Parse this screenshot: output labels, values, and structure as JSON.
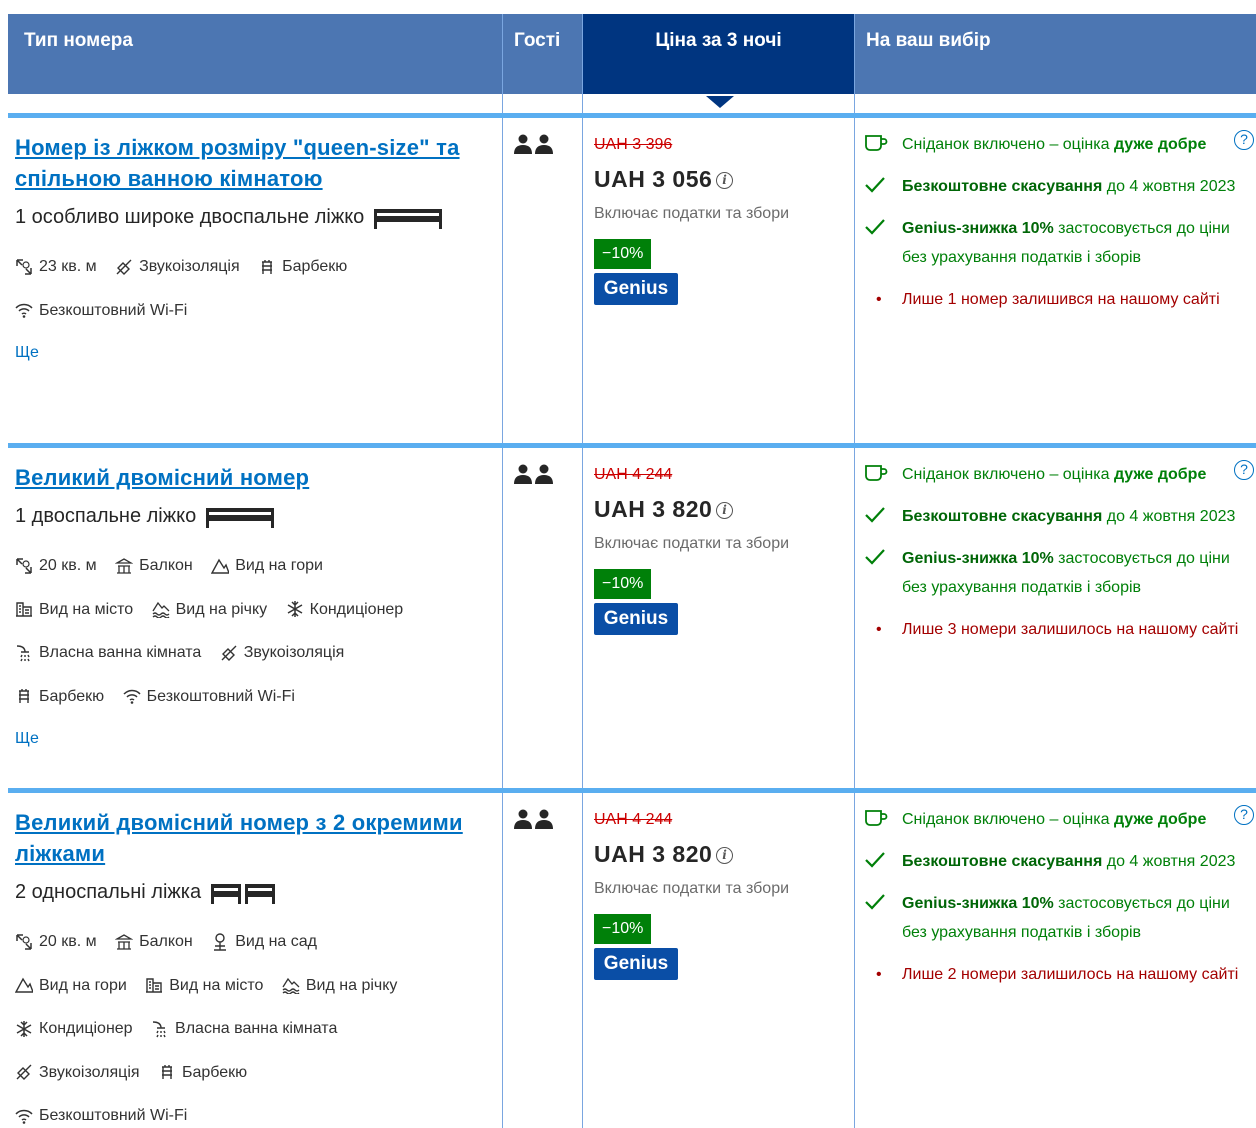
{
  "header": {
    "room_type": "Тип номера",
    "guests": "Гості",
    "price": "Ціна за 3 ночі",
    "choice": "На ваш вибір"
  },
  "rooms": [
    {
      "title": "Номер із ліжком розміру \"queen-size\" та спільною ванною кімнатою",
      "bed": "1 особливо широке двоспальне ліжко",
      "facilities": [
        {
          "icon": "area-icon",
          "label": "23 кв. м"
        },
        {
          "icon": "soundproof-icon",
          "label": "Звукоізоляція"
        },
        {
          "icon": "barbecue-icon",
          "label": "Барбекю"
        },
        {
          "icon": "wifi-icon",
          "label": "Безкоштовний Wi-Fi"
        }
      ],
      "more": "Ще",
      "old_price": "UAH 3 396",
      "new_price": "UAH 3 056",
      "taxes": "Включає податки та збори",
      "discount": "−10%",
      "genius": "Genius",
      "breakfast_pre": "Сніданок включено – оцінка ",
      "breakfast_bold": "дуже добре",
      "cancel_bold": "Безкоштовне скасування",
      "cancel_rest": " до 4 жовтня 2023",
      "genius_bold": "Genius-знижка 10%",
      "genius_rest": " застосовується до ціни без урахування податків і зборів",
      "left": "Лише 1 номер залишився на нашому сайті"
    },
    {
      "title": "Великий двомісний номер",
      "bed": "1 двоспальне ліжко",
      "facilities": [
        {
          "icon": "area-icon",
          "label": "20 кв. м"
        },
        {
          "icon": "balcony-icon",
          "label": "Балкон"
        },
        {
          "icon": "mountain-icon",
          "label": "Вид на гори"
        },
        {
          "icon": "city-icon",
          "label": "Вид на місто"
        },
        {
          "icon": "river-icon",
          "label": "Вид на річку"
        },
        {
          "icon": "snowflake-icon",
          "label": "Кондиціонер"
        },
        {
          "icon": "shower-icon",
          "label": "Власна ванна кімната"
        },
        {
          "icon": "soundproof-icon",
          "label": "Звукоізоляція"
        },
        {
          "icon": "barbecue-icon",
          "label": "Барбекю"
        },
        {
          "icon": "wifi-icon",
          "label": "Безкоштовний Wi-Fi"
        }
      ],
      "more": "Ще",
      "old_price": "UAH 4 244",
      "new_price": "UAH 3 820",
      "taxes": "Включає податки та збори",
      "discount": "−10%",
      "genius": "Genius",
      "breakfast_pre": "Сніданок включено – оцінка ",
      "breakfast_bold": "дуже добре",
      "cancel_bold": "Безкоштовне скасування",
      "cancel_rest": " до 4 жовтня 2023",
      "genius_bold": "Genius-знижка 10%",
      "genius_rest": " застосовується до ціни без урахування податків і зборів",
      "left": "Лише 3 номери залишилось на нашому сайті"
    },
    {
      "title": "Великий двомісний номер з 2 окремими ліжками",
      "bed": "2 односпальні ліжка",
      "facilities": [
        {
          "icon": "area-icon",
          "label": "20 кв. м"
        },
        {
          "icon": "balcony-icon",
          "label": "Балкон"
        },
        {
          "icon": "garden-icon",
          "label": "Вид на сад"
        },
        {
          "icon": "mountain-icon",
          "label": "Вид на гори"
        },
        {
          "icon": "city-icon",
          "label": "Вид на місто"
        },
        {
          "icon": "river-icon",
          "label": "Вид на річку"
        },
        {
          "icon": "snowflake-icon",
          "label": "Кондиціонер"
        },
        {
          "icon": "shower-icon",
          "label": "Власна ванна кімната"
        },
        {
          "icon": "soundproof-icon",
          "label": "Звукоізоляція"
        },
        {
          "icon": "barbecue-icon",
          "label": "Барбекю"
        },
        {
          "icon": "wifi-icon",
          "label": "Безкоштовний Wi-Fi"
        }
      ],
      "old_price": "UAH 4 244",
      "new_price": "UAH 3 820",
      "taxes": "Включає податки та збори",
      "discount": "−10%",
      "genius": "Genius",
      "breakfast_pre": "Сніданок включено – оцінка ",
      "breakfast_bold": "дуже добре",
      "cancel_bold": "Безкоштовне скасування",
      "cancel_rest": " до 4 жовтня 2023",
      "genius_bold": "Genius-знижка 10%",
      "genius_rest": " застосовується до ціни без урахування податків і зборів",
      "left": "Лише 2 номери залишилось на нашому сайті"
    }
  ],
  "colors": {
    "header_bg": "#4c76b2",
    "price_header_bg": "#003580",
    "link": "#0071c2",
    "green": "#008009",
    "red": "#cc0000",
    "genius_bg": "#0a4ea6"
  }
}
